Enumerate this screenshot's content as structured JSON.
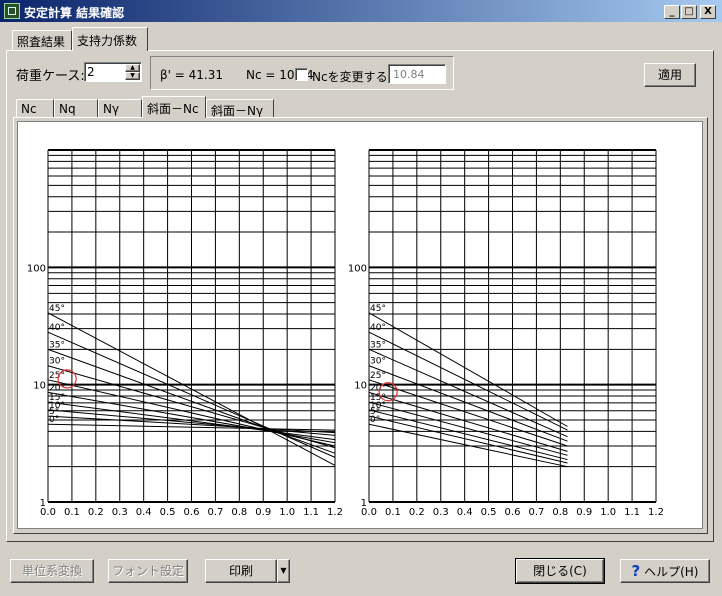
{
  "window": {
    "title": "安定計算 結果確認",
    "minimize": "_",
    "maximize": "□",
    "close": "X"
  },
  "top_tabs": [
    {
      "label": "照査結果"
    },
    {
      "label": "支持力係数"
    }
  ],
  "load_case": {
    "label": "荷重ケース:",
    "value": "2"
  },
  "info": {
    "beta": "β' = 41.31",
    "nc": "Nc = 10.84",
    "checkbox_label": "Ncを変更する",
    "nc_value": "10.84",
    "checkbox_checked": false
  },
  "apply_label": "適用",
  "sub_tabs": [
    {
      "label": "Nc"
    },
    {
      "label": "Nq"
    },
    {
      "label": "Nγ"
    },
    {
      "label": "斜面－Nc"
    },
    {
      "label": "斜面－Nγ"
    }
  ],
  "chart_data": [
    {
      "type": "line",
      "yscale": "log",
      "ylim": [
        1,
        1000
      ],
      "xlim": [
        0,
        1.2
      ],
      "ytick_labels": [
        "1",
        "10",
        "100"
      ],
      "xtick_labels": [
        "0.0",
        "0.1",
        "0.2",
        "0.3",
        "0.4",
        "0.5",
        "0.6",
        "0.7",
        "0.8",
        "0.9",
        "1.0",
        "1.1",
        "1.2"
      ],
      "curve_labels": [
        "45°",
        "40°",
        "35°",
        "30°",
        "25°",
        "20°",
        "15°",
        "10°",
        "5°",
        "0°"
      ],
      "series": [
        {
          "name": "45°",
          "x": [
            0,
            1.2
          ],
          "y": [
            41,
            2.05
          ]
        },
        {
          "name": "40°",
          "x": [
            0,
            1.2
          ],
          "y": [
            28,
            2.4
          ]
        },
        {
          "name": "35°",
          "x": [
            0,
            1.2
          ],
          "y": [
            20,
            2.6
          ]
        },
        {
          "name": "30°",
          "x": [
            0,
            1.2
          ],
          "y": [
            14.5,
            2.9
          ]
        },
        {
          "name": "25°",
          "x": [
            0,
            1.2
          ],
          "y": [
            11,
            3.0
          ]
        },
        {
          "name": "20°",
          "x": [
            0,
            1.2
          ],
          "y": [
            8.6,
            3.2
          ]
        },
        {
          "name": "15°",
          "x": [
            0,
            1.2
          ],
          "y": [
            7.1,
            3.4
          ]
        },
        {
          "name": "10°",
          "x": [
            0,
            1.2
          ],
          "y": [
            6.1,
            3.7
          ]
        },
        {
          "name": "5°",
          "x": [
            0,
            1.2
          ],
          "y": [
            5.4,
            3.9
          ]
        },
        {
          "name": "0°",
          "x": [
            0,
            1.2
          ],
          "y": [
            4.6,
            4.1
          ]
        }
      ],
      "marker": {
        "x": 0.08,
        "y": 11.2
      }
    },
    {
      "type": "line",
      "yscale": "log",
      "ylim": [
        1,
        1000
      ],
      "xlim": [
        0,
        1.2
      ],
      "ytick_labels": [
        "1",
        "10",
        "100"
      ],
      "xtick_labels": [
        "0.0",
        "0.1",
        "0.2",
        "0.3",
        "0.4",
        "0.5",
        "0.6",
        "0.7",
        "0.8",
        "0.9",
        "1.0",
        "1.1",
        "1.2"
      ],
      "curve_labels": [
        "45°",
        "40°",
        "35°",
        "30°",
        "25°",
        "20°",
        "15°",
        "10°",
        "5°",
        "0°"
      ],
      "series": [
        {
          "name": "45°",
          "x": [
            0,
            0.83
          ],
          "y": [
            41,
            4.4
          ]
        },
        {
          "name": "40°",
          "x": [
            0,
            0.83
          ],
          "y": [
            28,
            4.1
          ]
        },
        {
          "name": "35°",
          "x": [
            0,
            0.83
          ],
          "y": [
            20,
            3.6
          ]
        },
        {
          "name": "30°",
          "x": [
            0,
            0.83
          ],
          "y": [
            14.5,
            3.3
          ]
        },
        {
          "name": "25°",
          "x": [
            0,
            0.83
          ],
          "y": [
            11,
            3.0
          ]
        },
        {
          "name": "20°",
          "x": [
            0,
            0.83
          ],
          "y": [
            8.6,
            2.7
          ]
        },
        {
          "name": "15°",
          "x": [
            0,
            0.83
          ],
          "y": [
            7.1,
            2.5
          ]
        },
        {
          "name": "10°",
          "x": [
            0,
            0.83
          ],
          "y": [
            6.1,
            2.3
          ]
        },
        {
          "name": "5°",
          "x": [
            0,
            0.83
          ],
          "y": [
            5.4,
            2.15
          ]
        },
        {
          "name": "0°",
          "x": [
            0,
            0.83
          ],
          "y": [
            4.6,
            2.0
          ]
        }
      ],
      "marker": {
        "x": 0.08,
        "y": 8.7
      }
    }
  ],
  "bottom": {
    "unit_convert": "単位系変換",
    "font_settings": "フォント設定",
    "print": "印刷",
    "close": "閉じる(C)",
    "help": "ヘルプ(H)"
  }
}
